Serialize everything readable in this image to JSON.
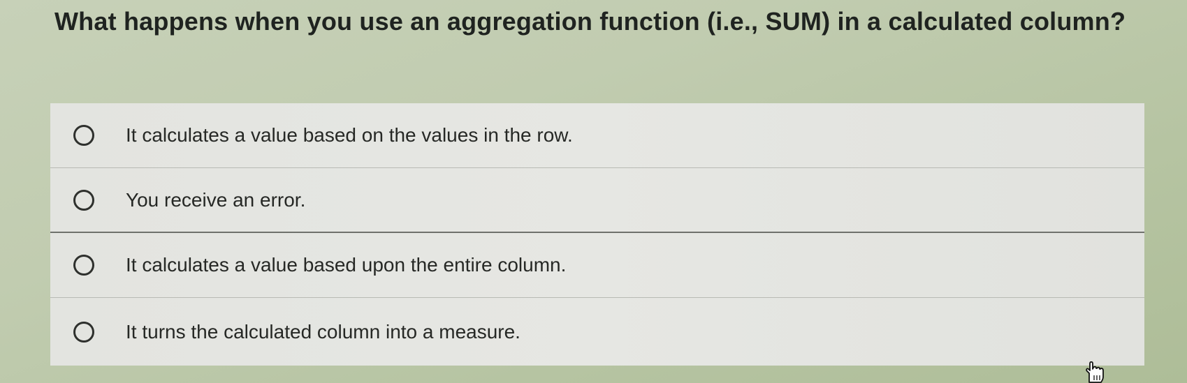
{
  "question": {
    "text": "What happens when you use an aggregation function (i.e., SUM) in a calculated column?"
  },
  "options": [
    {
      "label": "It calculates a value based on the values in the row.",
      "selected": false
    },
    {
      "label": "You receive an error.",
      "selected": false
    },
    {
      "label": "It calculates a value based upon the entire column.",
      "selected": false
    },
    {
      "label": "It turns the calculated column into a measure.",
      "selected": false
    }
  ],
  "colors": {
    "background": "#bfcbb0",
    "option_background": "#e4e5e1",
    "text": "#262825"
  },
  "cursor": {
    "icon": "hand-pointer-icon"
  }
}
